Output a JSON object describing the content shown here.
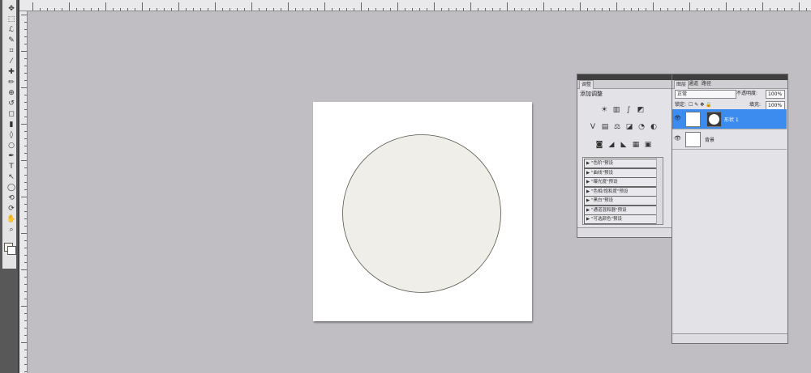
{
  "tools": {
    "icons": [
      "move-icon",
      "marquee-icon",
      "lasso-icon",
      "quick-select-icon",
      "crop-icon",
      "eyedropper-icon",
      "healing-icon",
      "brush-icon",
      "stamp-icon",
      "history-brush-icon",
      "eraser-icon",
      "gradient-icon",
      "blur-icon",
      "dodge-icon",
      "pen-icon",
      "type-icon",
      "path-select-icon",
      "shape-icon",
      "3d-rotate-icon",
      "3d-orbit-icon",
      "hand-icon",
      "zoom-icon"
    ],
    "glyphs": [
      "✥",
      "⬚",
      "ℒ",
      "✎",
      "⌗",
      "⁄",
      "✚",
      "✏",
      "⊕",
      "↺",
      "◻",
      "▮",
      "◊",
      "○",
      "✒",
      "T",
      "↖",
      "◯",
      "⟲",
      "⟳",
      "✋",
      "⌕"
    ],
    "colors": {
      "foreground": "#f3f0e8",
      "background": "#ffffff"
    }
  },
  "document": {
    "circle_fill": "#efeee9",
    "circle_stroke": "#55584a"
  },
  "adjustments": {
    "tab": "调整",
    "title": "添加调整",
    "icon_row1": [
      "☀",
      "▥",
      "∫",
      "◩"
    ],
    "icon_row2": [
      "V",
      "▤",
      "⚖",
      "◪",
      "◔",
      "◐"
    ],
    "icon_row3": [
      "◙",
      "◢",
      "◣",
      "▦",
      "▣"
    ],
    "presets": [
      "\"色阶\"预设",
      "\"曲线\"预设",
      "\"曝光度\"预设",
      "\"色相/饱和度\"预设",
      "\"黑白\"预设",
      "\"通道混和器\"预设",
      "\"可选颜色\"预设"
    ]
  },
  "layers": {
    "tabs": [
      "图层",
      "通道",
      "路径"
    ],
    "blend_mode": "正常",
    "opacity_label": "不透明度:",
    "opacity_value": "100%",
    "lock_label": "锁定:",
    "fill_label": "填充:",
    "fill_value": "100%",
    "items": [
      {
        "name": "形状 1",
        "selected": true
      },
      {
        "name": "背景",
        "selected": false
      }
    ]
  }
}
